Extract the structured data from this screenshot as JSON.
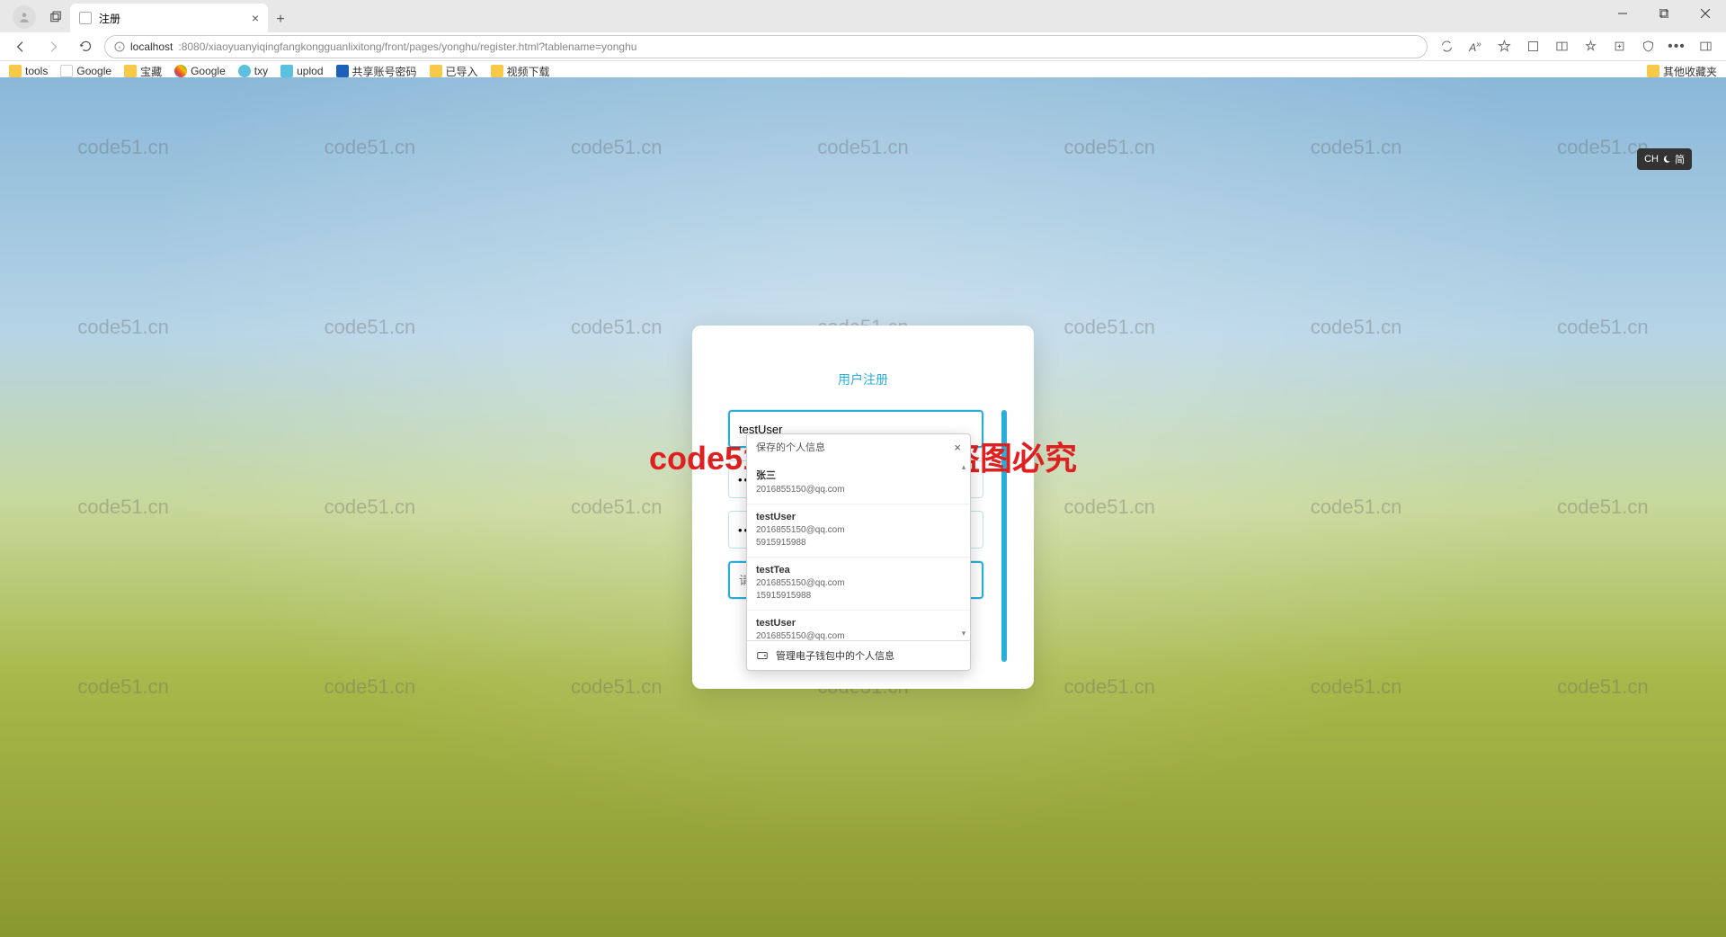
{
  "browser": {
    "tab_title": "注册",
    "url_origin": "localhost",
    "url_port_path": ":8080/xiaoyuanyiqingfangkongguanlixitong/front/pages/yonghu/register.html?tablename=yonghu"
  },
  "bookmarks": {
    "items": [
      "tools",
      "Google",
      "宝藏",
      "Google",
      "txy",
      "uplod",
      "共享账号密码",
      "已导入",
      "视频下载"
    ],
    "other": "其他收藏夹"
  },
  "watermark": {
    "text": "code51.cn",
    "main": "code51.cn-源码乐园盗图必究"
  },
  "register": {
    "title": "用户注册",
    "username_value": "testUser",
    "password_value": "••••••••",
    "confirm_value": "••••••••",
    "name_placeholder": "请输入用户姓名"
  },
  "autofill": {
    "header": "保存的个人信息",
    "items": [
      {
        "name": "张三",
        "lines": [
          "2016855150@qq.com"
        ]
      },
      {
        "name": "testUser",
        "lines": [
          "2016855150@qq.com",
          "5915915988"
        ]
      },
      {
        "name": "testTea",
        "lines": [
          "2016855150@qq.com",
          "15915915988"
        ]
      },
      {
        "name": "testUser",
        "lines": [
          "2016855150@qq.com"
        ]
      }
    ],
    "footer": "管理电子钱包中的个人信息"
  },
  "ime": {
    "label": "CH",
    "mode": "简"
  }
}
